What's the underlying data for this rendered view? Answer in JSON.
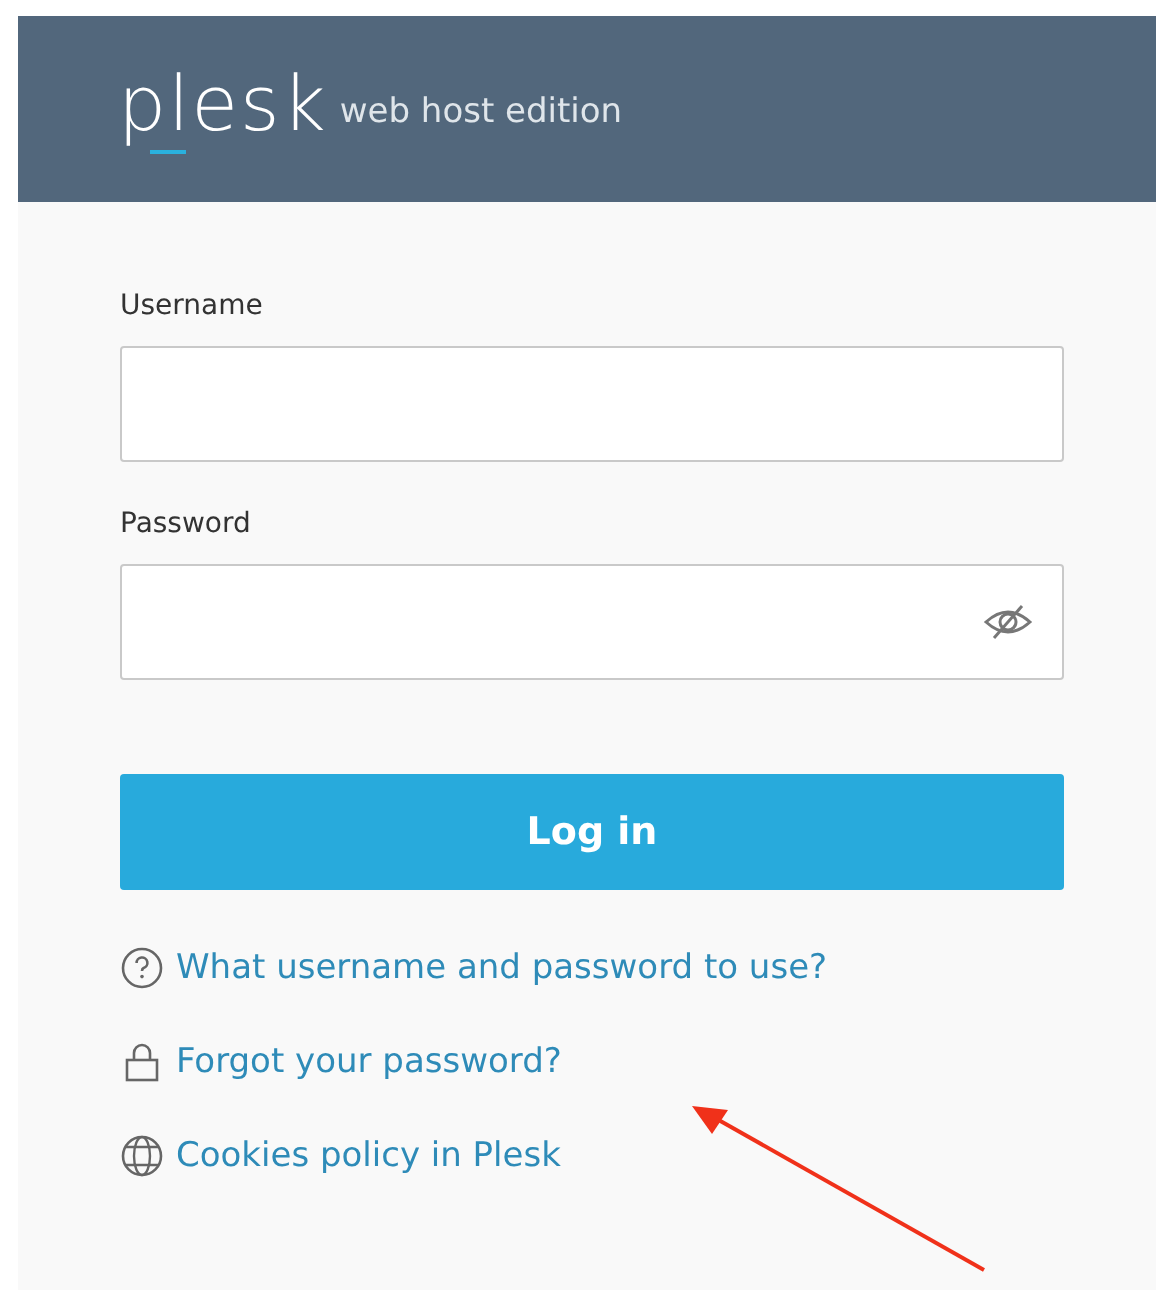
{
  "header": {
    "logo": "plesk",
    "edition": "web host edition"
  },
  "fields": [
    {
      "label": "Username",
      "kind": "text"
    },
    {
      "label": "Password",
      "kind": "password"
    }
  ],
  "submit": "Log in",
  "links": [
    {
      "kind": "help",
      "text": "What username and password to use?"
    },
    {
      "kind": "lock",
      "text": "Forgot your password?"
    },
    {
      "kind": "globe",
      "text": "Cookies policy in Plesk"
    }
  ]
}
